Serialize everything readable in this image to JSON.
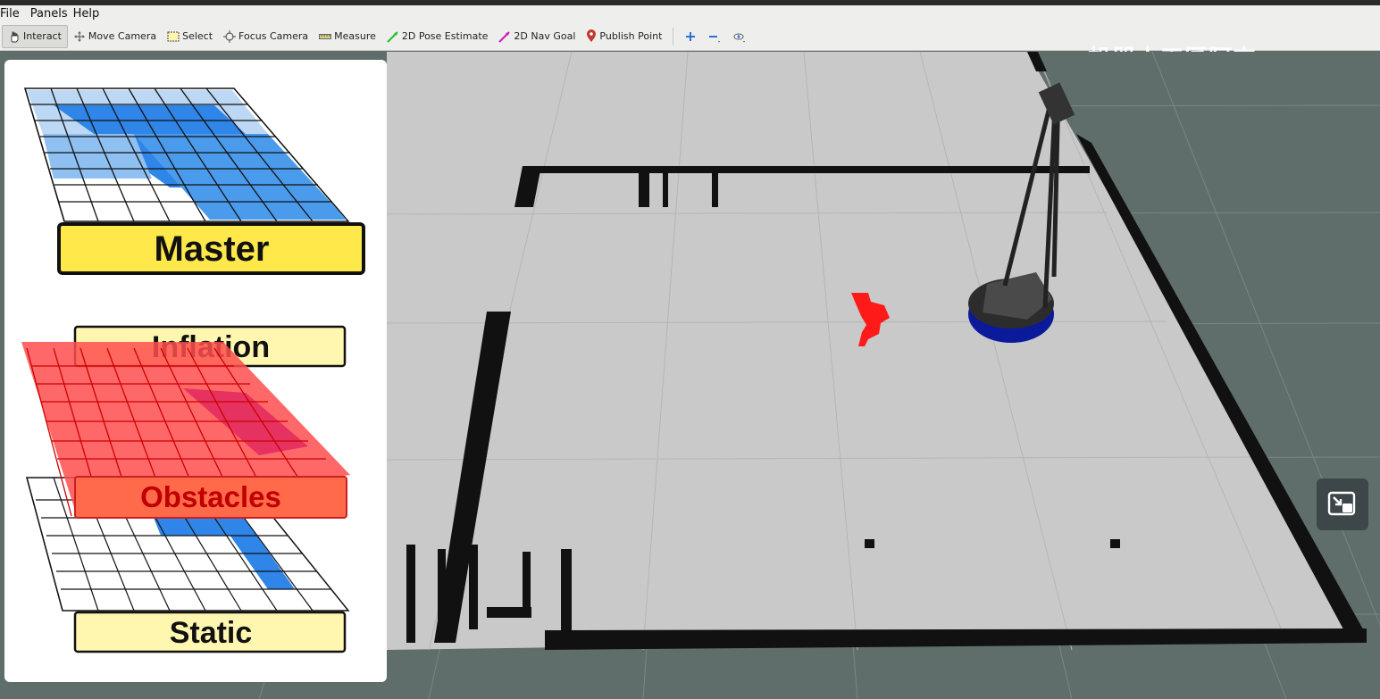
{
  "menu": {
    "file": "File",
    "panels": "Panels",
    "help": "Help"
  },
  "toolbar": {
    "interact": "Interact",
    "move_camera": "Move Camera",
    "select": "Select",
    "focus_camera": "Focus Camera",
    "measure": "Measure",
    "pose_estimate": "2D Pose Estimate",
    "nav_goal": "2D Nav Goal",
    "publish_point": "Publish Point"
  },
  "watermark": "机器人工匠阿杰",
  "costmap_diagram": {
    "master_label": "Master",
    "inflation_label": "Inflation",
    "obstacles_label": "Obstacles",
    "static_label": "Static"
  },
  "colors": {
    "grid_bg": "#5f6e6b",
    "map_floor": "#c9c9c9",
    "wall": "#111111",
    "obstacle_red": "#ff1a1a",
    "master_yellow": "#ffe84a",
    "layer_yellow": "#fff7b0",
    "obstacle_layer": "#ff5a5a",
    "costmap_blue": "#2f86e8"
  }
}
